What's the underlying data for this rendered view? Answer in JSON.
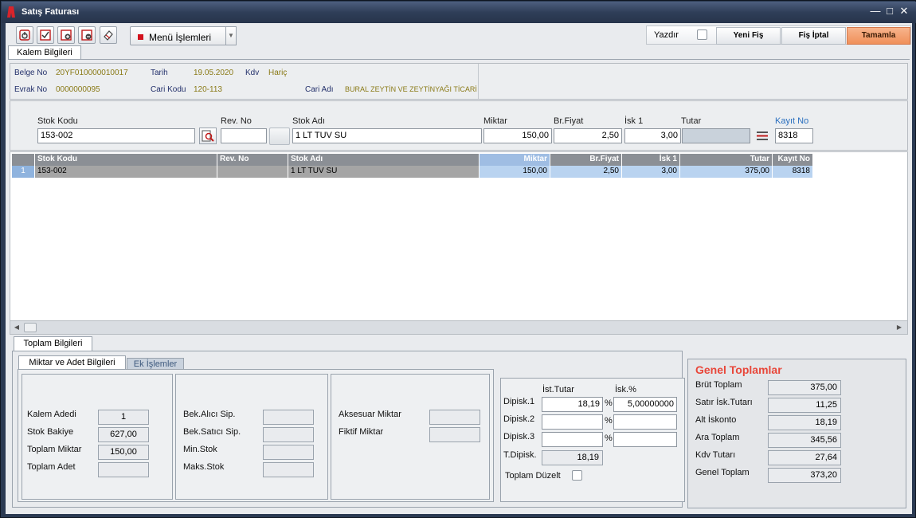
{
  "window": {
    "title": "Satış Faturası"
  },
  "toolbar": {
    "menu_label": "Menü İşlemleri",
    "print_label": "Yazdır",
    "new_slip_label": "Yeni Fiş",
    "cancel_slip_label": "Fiş İptal",
    "complete_label": "Tamamla",
    "accent_color": "#f0905a"
  },
  "tabs": {
    "item_info": "Kalem Bilgileri",
    "totals_info": "Toplam Bilgileri",
    "qty_info": "Miktar ve Adet Bilgileri",
    "extra_ops": "Ek İşlemler"
  },
  "header": {
    "belge_no_label": "Belge No",
    "belge_no": "20YF010000010017",
    "tarih_label": "Tarih",
    "tarih": "19.05.2020",
    "kdv_label": "Kdv",
    "kdv": "Hariç",
    "evrak_no_label": "Evrak No",
    "evrak_no": "0000000095",
    "cari_kodu_label": "Cari Kodu",
    "cari_kodu": "120-113",
    "cari_adi_label": "Cari Adı",
    "cari_adi": "BURAL ZEYTİN VE ZEYTİNYAĞI TİCARİ"
  },
  "entry": {
    "stok_kodu_label": "Stok Kodu",
    "stok_kodu": "153-002",
    "rev_no_label": "Rev. No",
    "rev_no": "",
    "stok_adi_label": "Stok Adı",
    "stok_adi": "1 LT TUV SU",
    "miktar_label": "Miktar",
    "miktar": "150,00",
    "br_fiyat_label": "Br.Fiyat",
    "br_fiyat": "2,50",
    "isk1_label": "İsk 1",
    "isk1": "3,00",
    "tutar_label": "Tutar",
    "tutar": "",
    "kayit_no_label": "Kayıt No",
    "kayit_no": "8318"
  },
  "grid": {
    "headers": [
      "Stok Kodu",
      "Rev. No",
      "Stok Adı",
      "Miktar",
      "Br.Fiyat",
      "İsk 1",
      "Tutar",
      "Kayıt No"
    ],
    "rows": [
      {
        "num": "1",
        "stok_kodu": "153-002",
        "rev_no": "",
        "stok_adi": "1 LT TUV SU",
        "miktar": "150,00",
        "br_fiyat": "2,50",
        "isk1": "3,00",
        "tutar": "375,00",
        "kayit_no": "8318"
      }
    ]
  },
  "qty": {
    "kalem_adedi_label": "Kalem Adedi",
    "kalem_adedi": "1",
    "stok_bakiye_label": "Stok Bakiye",
    "stok_bakiye": "627,00",
    "toplam_miktar_label": "Toplam Miktar",
    "toplam_miktar": "150,00",
    "toplam_adet_label": "Toplam Adet",
    "toplam_adet": "",
    "bek_alici_label": "Bek.Alıcı Sip.",
    "bek_satici_label": "Bek.Satıcı Sip.",
    "min_stok_label": "Min.Stok",
    "maks_stok_label": "Maks.Stok",
    "aksesuar_label": "Aksesuar Miktar",
    "fiktif_label": "Fiktif Miktar"
  },
  "discount": {
    "ist_tutar_label": "İst.Tutar",
    "isk_pct_label": "İsk.%",
    "dip1_label": "Dipisk.1",
    "dip1_tutar": "18,19",
    "dip1_pct": "5,00000000",
    "dip2_label": "Dipisk.2",
    "dip2_tutar": "",
    "dip2_pct": "",
    "dip3_label": "Dipisk.3",
    "dip3_tutar": "",
    "dip3_pct": "",
    "pct_sign": "%",
    "t_dip_label": "T.Dipisk.",
    "t_dip": "18,19",
    "toplam_duzelt_label": "Toplam Düzelt"
  },
  "totals": {
    "title": "Genel Toplamlar",
    "title_color": "#e8473a",
    "brut_label": "Brüt Toplam",
    "brut": "375,00",
    "satir_isk_label": "Satır İsk.Tutarı",
    "satir_isk": "11,25",
    "alt_isk_label": "Alt İskonto",
    "alt_isk": "18,19",
    "ara_label": "Ara Toplam",
    "ara": "345,56",
    "kdv_label": "Kdv Tutarı",
    "kdv": "27,64",
    "genel_label": "Genel Toplam",
    "genel": "373,20"
  }
}
